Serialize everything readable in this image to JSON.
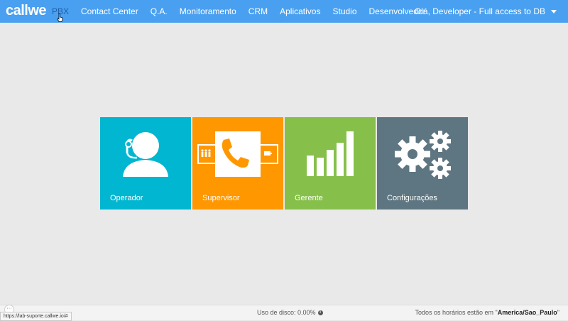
{
  "brand": {
    "logo_text": "callwe"
  },
  "nav": {
    "items": [
      {
        "label": "PBX"
      },
      {
        "label": "Contact Center"
      },
      {
        "label": "Q.A."
      },
      {
        "label": "Monitoramento"
      },
      {
        "label": "CRM"
      },
      {
        "label": "Aplicativos"
      },
      {
        "label": "Studio"
      },
      {
        "label": "Desenvolvedor"
      }
    ],
    "active_color": "#1f5fa8",
    "bar_color": "#4aa0f0"
  },
  "user_menu": {
    "label": "Olá, Developer - Full access to DB",
    "icon": "caret-down-icon"
  },
  "tiles": [
    {
      "label": "Operador",
      "color": "#00b6d0",
      "icon": "headset-operator-icon"
    },
    {
      "label": "Supervisor",
      "color": "#ff9700",
      "icon": "phone-supervisor-icon"
    },
    {
      "label": "Gerente",
      "color": "#86c04b",
      "icon": "bar-chart-icon"
    },
    {
      "label": "Configurações",
      "color": "#5e7681",
      "icon": "gears-icon"
    }
  ],
  "footer": {
    "disk_usage": "Uso de disco: 0.00%",
    "timezone_prefix": "Todos os horários estão em \"",
    "timezone": "America/Sao_Paulo",
    "timezone_suffix": "\""
  },
  "status_url": "https://lab-suporte.callwe.io/#",
  "chat_bubble": "···"
}
